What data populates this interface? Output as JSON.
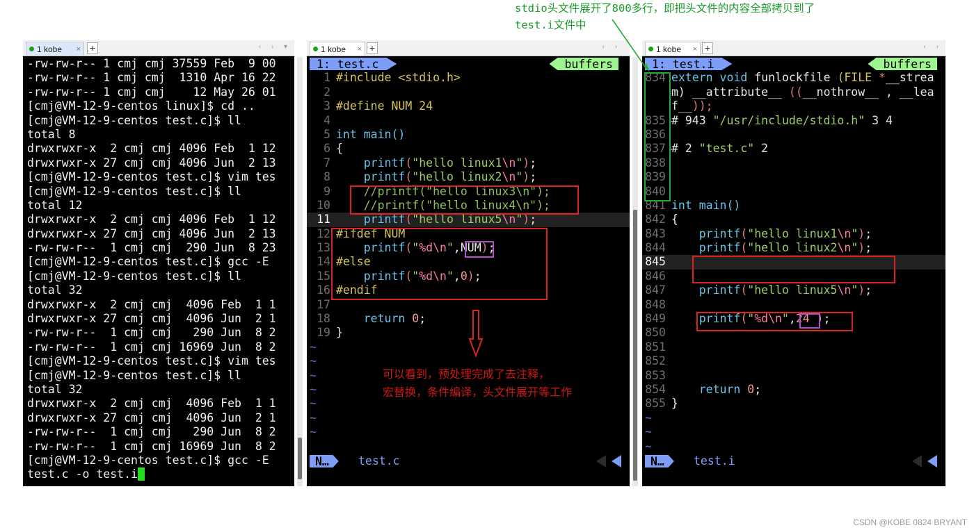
{
  "colors": {
    "terminal_bg": "#000000",
    "terminal_fg": "#f0f0f0",
    "cursor": "#22dd22",
    "vim_tab": "#7c9ef7",
    "vim_buffers": "#9ef58f",
    "annotation_red": "#d01818",
    "annotation_green": "#1a9a2a",
    "highlight_purple": "#b250c8"
  },
  "annotations": {
    "top_green_line1": "stdio头文件展开了800多行，即把头文件的内容全部拷贝到了",
    "top_green_line2": "test.i文件中",
    "red_line1": "可以看到，预处理完成了去注释，",
    "red_line2": "宏替换，条件编译，头文件展开等工作",
    "watermark": "CSDN @KOBE 0824 BRYANT"
  },
  "pane1": {
    "tab_label": "1 kobe",
    "close_icon": "×",
    "plus_icon": "+",
    "terminal_lines": [
      "-rw-rw-r-- 1 cmj cmj 37559 Feb  9 00",
      "-rw-rw-r-- 1 cmj cmj  1310 Apr 16 22",
      "-rw-rw-r-- 1 cmj cmj    12 May 26 01",
      "[cmj@VM-12-9-centos linux]$ cd ..",
      "[cmj@VM-12-9-centos test.c]$ ll",
      "total 8",
      "drwxrwxr-x  2 cmj cmj 4096 Feb  1 12",
      "drwxrwxr-x 27 cmj cmj 4096 Jun  2 13",
      "[cmj@VM-12-9-centos test.c]$ vim tes",
      "[cmj@VM-12-9-centos test.c]$ ll",
      "total 12",
      "drwxrwxr-x  2 cmj cmj 4096 Feb  1 12",
      "drwxrwxr-x 27 cmj cmj 4096 Jun  2 13",
      "-rw-rw-r--  1 cmj cmj  290 Jun  8 23",
      "[cmj@VM-12-9-centos test.c]$ gcc -E",
      "[cmj@VM-12-9-centos test.c]$ ll",
      "total 32",
      "drwxrwxr-x  2 cmj cmj  4096 Feb  1 1",
      "drwxrwxr-x 27 cmj cmj  4096 Jun  2 1",
      "-rw-rw-r--  1 cmj cmj   290 Jun  8 2",
      "-rw-rw-r--  1 cmj cmj 16969 Jun  8 2",
      "[cmj@VM-12-9-centos test.c]$ vim tes",
      "[cmj@VM-12-9-centos test.c]$ ll",
      "total 32",
      "drwxrwxr-x  2 cmj cmj  4096 Feb  1 1",
      "drwxrwxr-x 27 cmj cmj  4096 Jun  2 1",
      "-rw-rw-r--  1 cmj cmj   290 Jun  8 2",
      "-rw-rw-r--  1 cmj cmj 16969 Jun  8 2",
      "[cmj@VM-12-9-centos test.c]$ gcc -E"
    ],
    "input_line": "test.c -o test.i"
  },
  "pane2": {
    "tab_label": "1 kobe",
    "vim_tab": "1: test.c",
    "buffers": "buffers",
    "mode": "N…",
    "filename": "test.c",
    "line_numbers": [
      "1",
      "2",
      "3",
      "4",
      "5",
      "6",
      "7",
      "8",
      "9",
      "10",
      "11",
      "12",
      "13",
      "14",
      "15",
      "16",
      "17",
      "18",
      "19"
    ],
    "code": {
      "l1": "#include <stdio.h>",
      "l3": "#define NUM 24",
      "l5a": "int",
      "l5b": " main()",
      "l6": "{",
      "printf": "printf",
      "hello1": "hello linux1",
      "hello2": "hello linux2",
      "c9": "//printf(\"hello linux3\\n\");",
      "c10": "//printf(\"hello linux4\\n\");",
      "hello5": "hello linux5",
      "esc": "\\n",
      "l12": "#ifdef NUM",
      "fmt": "%d",
      "num_macro": "NUM",
      "l14": "#else",
      "zero": "0",
      "l16": "#endif",
      "ret": "return",
      "l19": "}"
    },
    "tilde_count": 7
  },
  "pane3": {
    "tab_label": "1 kobe",
    "vim_tab": "1: test.i",
    "buffers": "buffers",
    "mode": "N…",
    "filename": "test.i",
    "line_numbers": [
      "834",
      "",
      "",
      "835",
      "836",
      "837",
      "838",
      "839",
      "840",
      "841",
      "842",
      "843",
      "844",
      "845",
      "846",
      "847",
      "848",
      "849",
      "850",
      "851",
      "852",
      "853",
      "854",
      "855"
    ],
    "code": {
      "l834a": "extern ",
      "l834b": "void",
      "l834c": " funlockfile ",
      "l834d": "(FILE ",
      "l834e": "*",
      "l834f": "__strea",
      "l834g": "m) __attribute__ ",
      "l834h": "((",
      "l834i": "__nothrow__ ",
      "l834j": ", __lea",
      "l834k": "f__",
      "l834l": "));",
      "l835a": "# 943 ",
      "l835b": "\"/usr/include/stdio.h\"",
      "l835c": " 3 4",
      "l837a": "# 2 ",
      "l837b": "\"test.c\"",
      "l837c": " 2",
      "l841a": "int",
      "l841b": " main()",
      "l842": "{",
      "printf": "printf",
      "hello1": "hello linux1",
      "hello2": "hello linux2",
      "hello5": "hello linux5",
      "esc": "\\n",
      "fmt": "%d",
      "num_value": "24",
      "ret": "return",
      "zero": "0",
      "l855": "}"
    },
    "tilde_count": 3
  }
}
